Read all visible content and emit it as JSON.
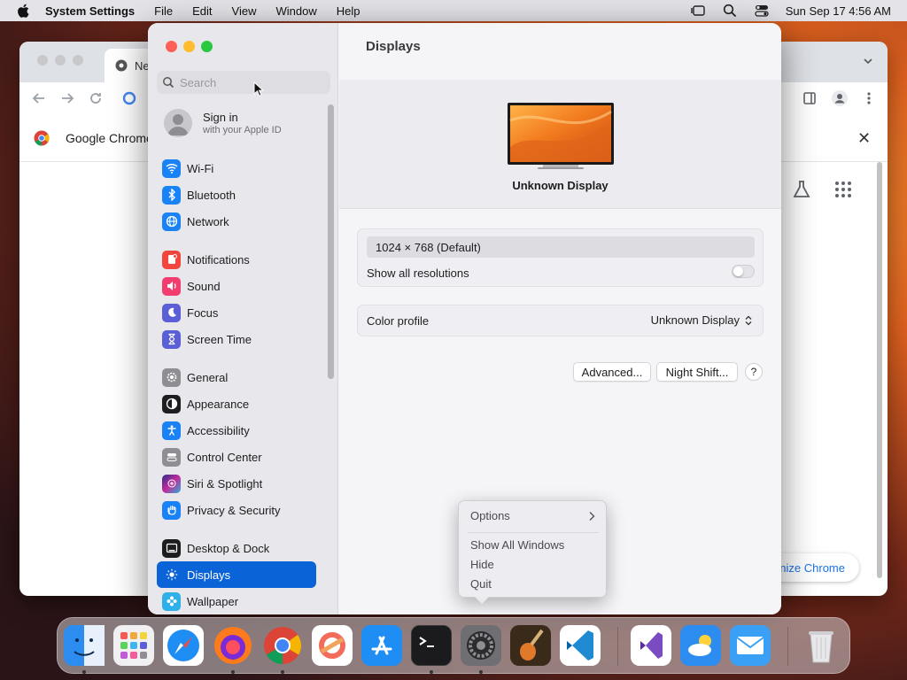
{
  "menubar": {
    "app_name": "System Settings",
    "items": [
      "File",
      "Edit",
      "View",
      "Window",
      "Help"
    ],
    "clock": "Sun Sep 17  4:56 AM"
  },
  "chrome": {
    "tab_label": "Ne",
    "infobar_text": "Google Chrome",
    "customize_label": "nize Chrome"
  },
  "settings": {
    "search": {
      "placeholder": "Search",
      "value": ""
    },
    "signin": {
      "title": "Sign in",
      "subtitle": "with your Apple ID"
    },
    "sidebar": [
      {
        "label": "Wi-Fi",
        "icon": "wifi-icon",
        "color": "#1a82f7"
      },
      {
        "label": "Bluetooth",
        "icon": "bluetooth-icon",
        "color": "#1a82f7"
      },
      {
        "label": "Network",
        "icon": "globe-icon",
        "color": "#1a82f7"
      },
      {
        "label": "Notifications",
        "icon": "bell-icon",
        "color": "#f2453d"
      },
      {
        "label": "Sound",
        "icon": "speaker-icon",
        "color": "#f23d6e"
      },
      {
        "label": "Focus",
        "icon": "moon-icon",
        "color": "#5b5fd6"
      },
      {
        "label": "Screen Time",
        "icon": "hourglass-icon",
        "color": "#5b5fd6"
      },
      {
        "label": "General",
        "icon": "gear-icon",
        "color": "#8e8e93"
      },
      {
        "label": "Appearance",
        "icon": "appearance-icon",
        "color": "#1d1d1f"
      },
      {
        "label": "Accessibility",
        "icon": "accessibility-icon",
        "color": "#1a82f7"
      },
      {
        "label": "Control Center",
        "icon": "control-center-icon",
        "color": "#8e8e93"
      },
      {
        "label": "Siri & Spotlight",
        "icon": "siri-icon",
        "color": "#8a3ac2"
      },
      {
        "label": "Privacy & Security",
        "icon": "hand-icon",
        "color": "#1a82f7"
      },
      {
        "label": "Desktop & Dock",
        "icon": "dock-icon",
        "color": "#1d1d1f"
      },
      {
        "label": "Displays",
        "icon": "sun-icon",
        "color": "#1a82f7",
        "selected": true
      },
      {
        "label": "Wallpaper",
        "icon": "flower-icon",
        "color": "#30b0e8"
      }
    ],
    "content": {
      "title": "Displays",
      "display_name": "Unknown Display",
      "resolution": "1024 × 768 (Default)",
      "show_all_resolutions_label": "Show all resolutions",
      "show_all_resolutions_on": false,
      "color_profile_label": "Color profile",
      "color_profile_value": "Unknown Display",
      "advanced_label": "Advanced...",
      "night_shift_label": "Night Shift...",
      "help_label": "?"
    }
  },
  "context_menu": {
    "items": [
      "Options",
      "Show All Windows",
      "Hide",
      "Quit"
    ]
  },
  "dock": {
    "apps": [
      {
        "name": "finder-app",
        "running": true
      },
      {
        "name": "launchpad-app",
        "running": false
      },
      {
        "name": "safari-app",
        "running": false
      },
      {
        "name": "firefox-app",
        "running": true
      },
      {
        "name": "chrome-app",
        "running": true
      },
      {
        "name": "arc-app",
        "running": false
      },
      {
        "name": "app-store-app",
        "running": false
      },
      {
        "name": "terminal-app",
        "running": true
      },
      {
        "name": "system-settings-app",
        "running": true
      },
      {
        "name": "garageband-app",
        "running": false
      },
      {
        "name": "vscode-app",
        "running": false
      },
      {
        "name": "visual-studio-app",
        "running": false
      },
      {
        "name": "weather-app",
        "running": false
      },
      {
        "name": "mail-app",
        "running": false
      },
      {
        "name": "trash-app",
        "running": false
      }
    ]
  },
  "colors": {
    "selection_blue": "#0a64d8",
    "traffic_red": "#ff5f57",
    "traffic_yellow": "#febc2e",
    "traffic_green": "#28c840"
  }
}
